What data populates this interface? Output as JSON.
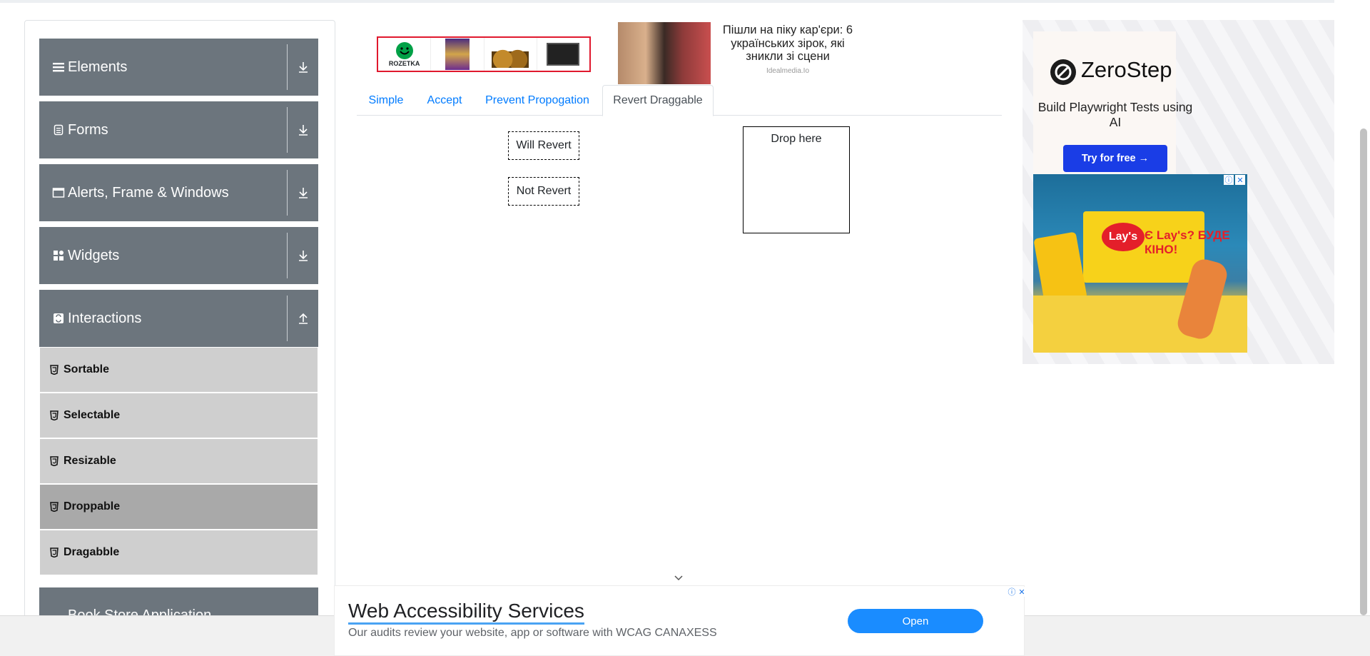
{
  "sidebar": {
    "groups": [
      {
        "label": "Elements",
        "icon": "hamburger-icon",
        "arrow": "download-arrow-icon"
      },
      {
        "label": "Forms",
        "icon": "form-icon",
        "arrow": "download-arrow-icon"
      },
      {
        "label": "Alerts, Frame & Windows",
        "icon": "window-icon",
        "arrow": "download-arrow-icon"
      },
      {
        "label": "Widgets",
        "icon": "widgets-grid-icon",
        "arrow": "download-arrow-icon"
      },
      {
        "label": "Interactions",
        "icon": "interactions-icon",
        "arrow": "upload-arrow-icon"
      },
      {
        "label": "Book Store Application",
        "icon": "book-icon",
        "arrow": "download-arrow-icon"
      }
    ],
    "interactions_items": [
      {
        "label": "Sortable",
        "active": false
      },
      {
        "label": "Selectable",
        "active": false
      },
      {
        "label": "Resizable",
        "active": false
      },
      {
        "label": "Droppable",
        "active": true
      },
      {
        "label": "Dragabble",
        "active": false
      }
    ]
  },
  "ads": {
    "top_left": {
      "brand": "ROZETKA"
    },
    "news": {
      "text": "Пішли на піку кар'єри: 6 українських зірок, які зникли зі сцени",
      "source": "Idealmedia.Io"
    },
    "zerostep": {
      "title": "ZeroStep",
      "subtitle": "Build Playwright Tests using AI",
      "button": "Try for free →"
    },
    "lays": {
      "logo": "Lay's",
      "headline": "Є Lay's? БУДЕ КІНО!"
    },
    "bottom": {
      "title": "Web Accessibility Services",
      "description": "Our audits review your website, app or software with WCAG CANAXESS",
      "button": "Open"
    }
  },
  "tabs": [
    {
      "label": "Simple",
      "active": false
    },
    {
      "label": "Accept",
      "active": false
    },
    {
      "label": "Prevent Propogation",
      "active": false
    },
    {
      "label": "Revert Draggable",
      "active": true
    }
  ],
  "content": {
    "will_revert": "Will Revert",
    "not_revert": "Not Revert",
    "drop_here": "Drop here"
  },
  "colors": {
    "sidebar_header": "#6c757d",
    "menu_item": "#cfcfcf",
    "menu_item_active": "#a9a9a9",
    "tab_link": "#007bff",
    "zerostep_button": "#1a3de6",
    "open_button": "#1a8cff"
  }
}
